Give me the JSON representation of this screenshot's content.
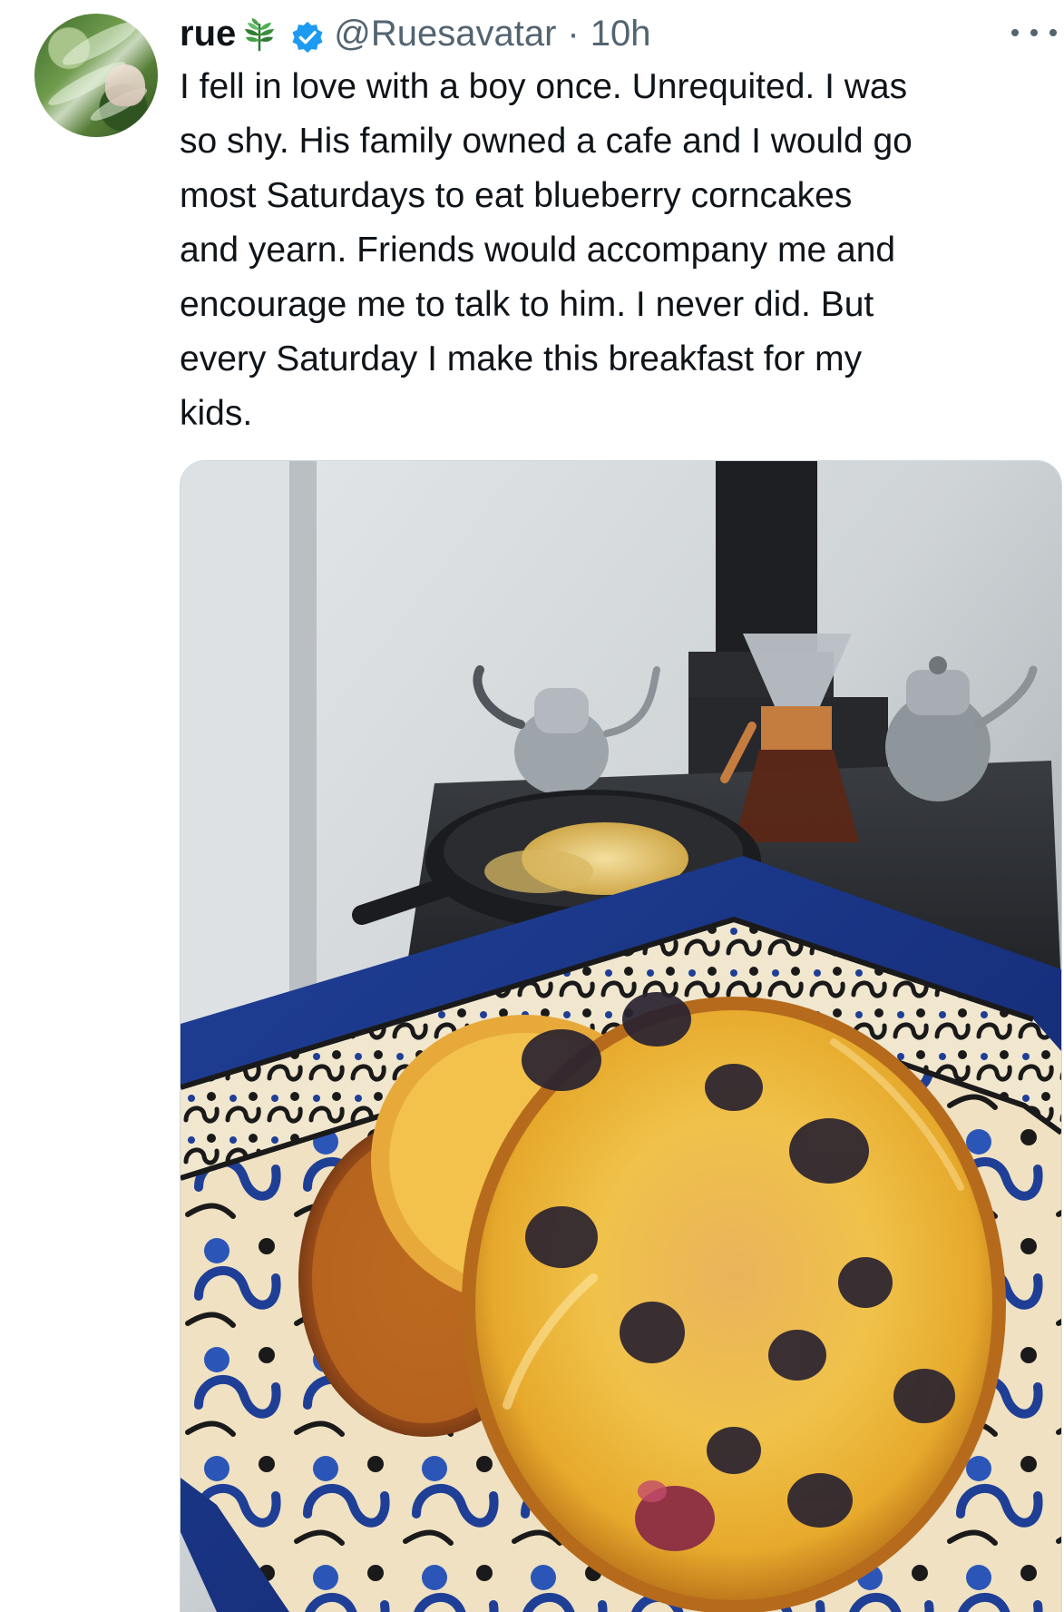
{
  "tweet": {
    "avatar_icon": "avatar",
    "display_name": "rue",
    "display_name_emoji_icon": "sprout-icon",
    "verified_icon": "verified-badge-icon",
    "handle": "@Ruesavatar",
    "separator": "·",
    "timestamp": "10h",
    "more_icon": "more-horizontal-icon",
    "text": "I fell in love with a boy once. Unrequited. I was\nso shy. His family owned a cafe and I would go\nmost Saturdays to eat blueberry corncakes\nand yearn. Friends would accompany me and\nencourage me to talk to him. I never did. But\nevery Saturday I make this breakfast for my\nkids.",
    "media": {
      "kind": "photo",
      "subject": "blueberry corncakes"
    }
  },
  "colors": {
    "text_primary": "#0f1419",
    "text_secondary": "#536471",
    "verified_blue": "#1d9bf0",
    "border": "#cfd9de"
  }
}
